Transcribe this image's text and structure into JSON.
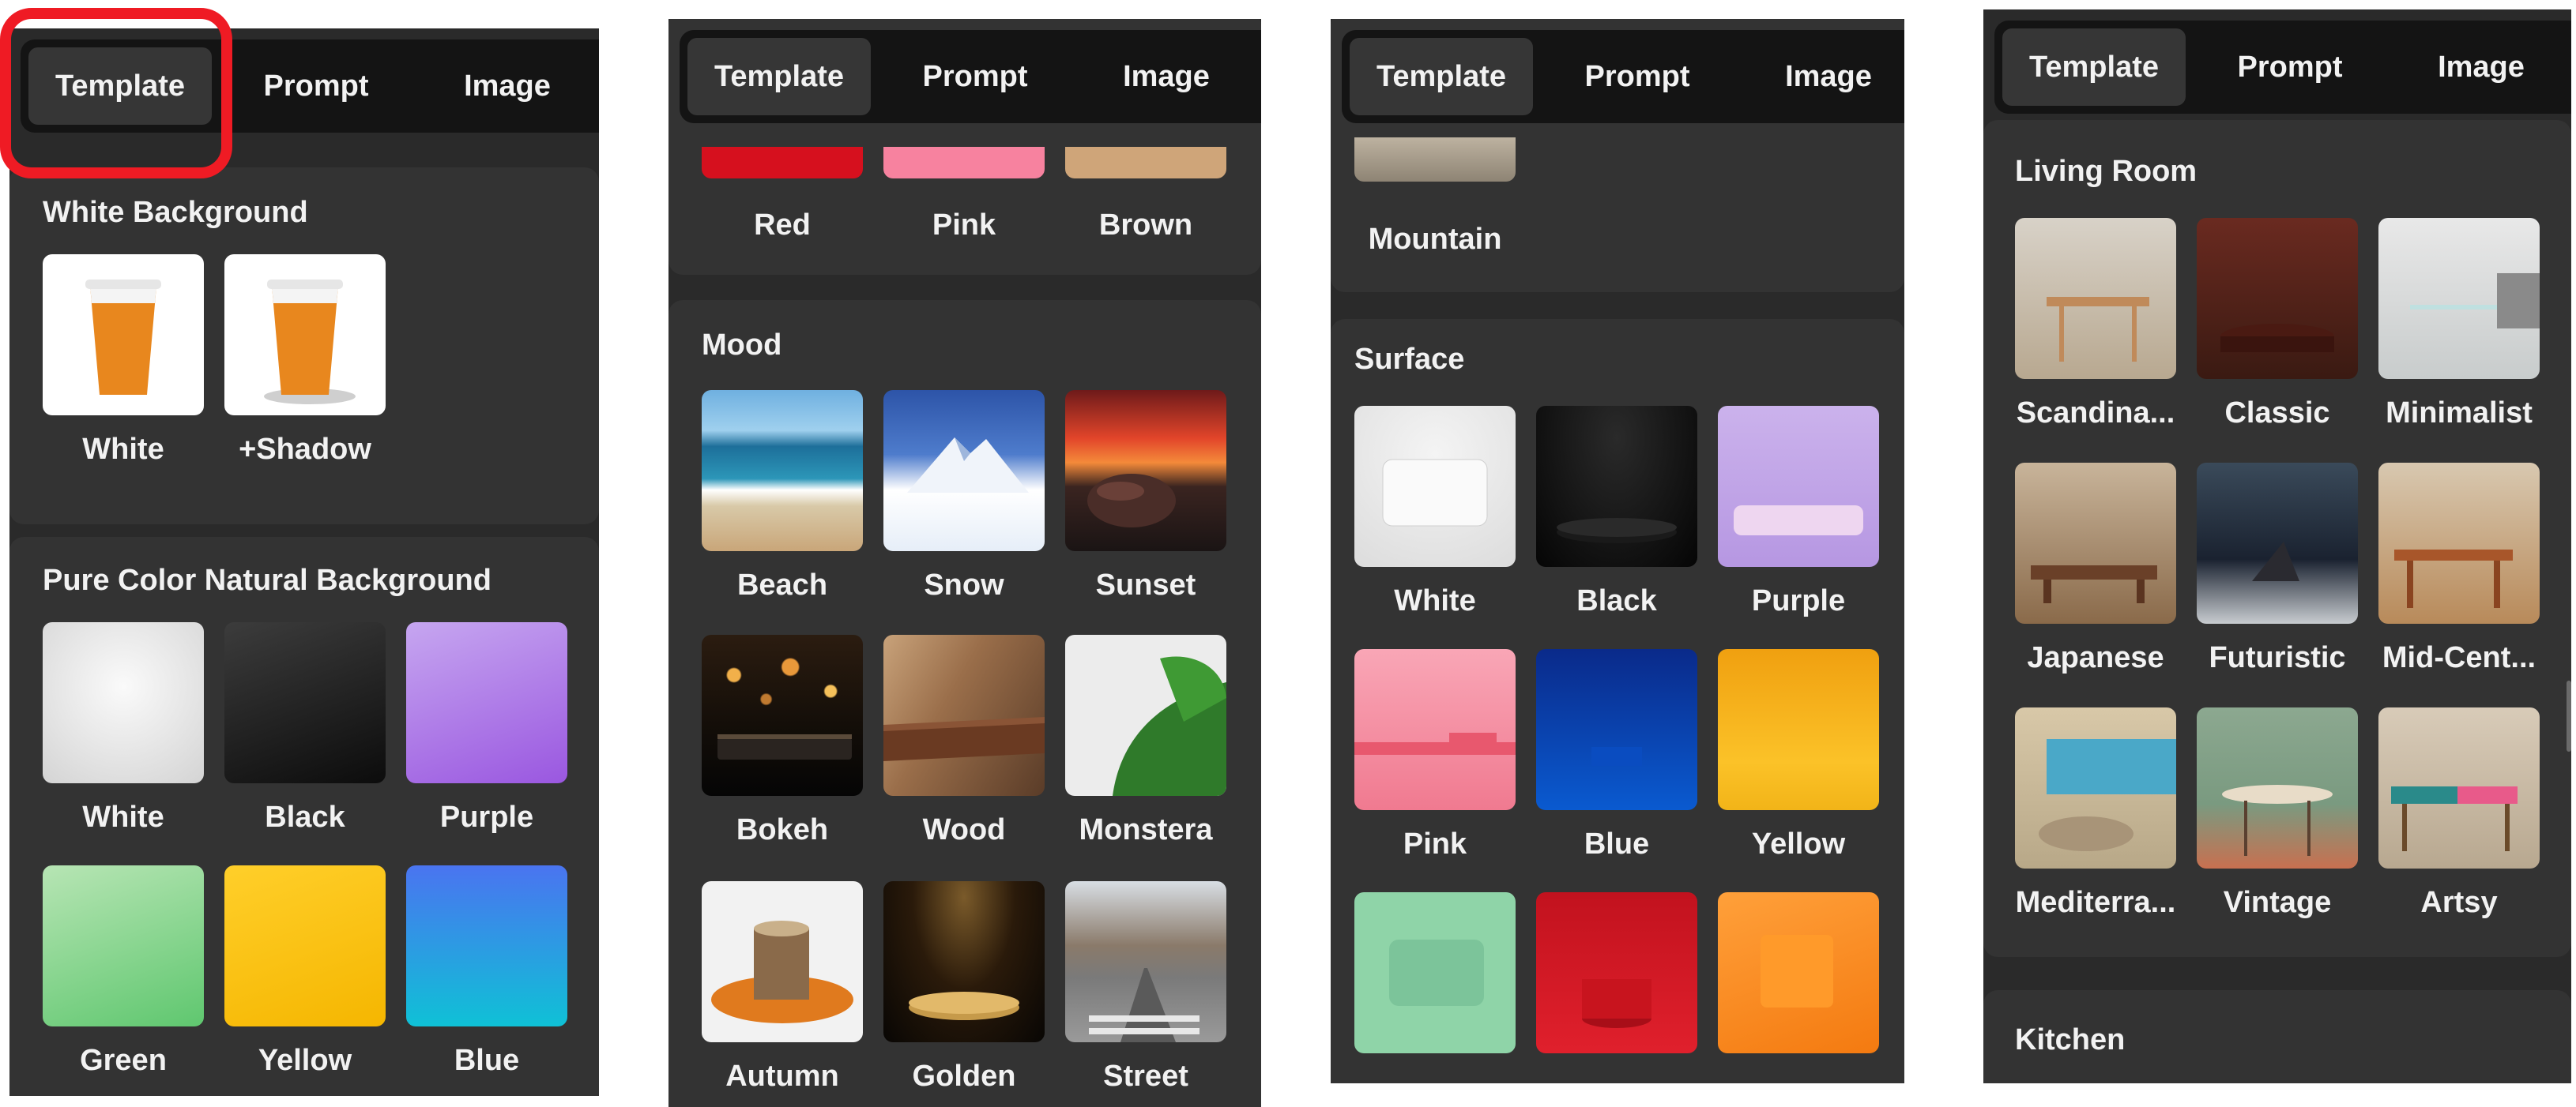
{
  "tabs": [
    "Template",
    "Prompt",
    "Image"
  ],
  "panel1": {
    "white_bg": {
      "title": "White Background",
      "items": [
        "White",
        "+Shadow"
      ]
    },
    "pure_bg": {
      "title": "Pure Color Natural Background",
      "items": [
        "White",
        "Black",
        "Purple",
        "Green",
        "Yellow",
        "Blue"
      ]
    }
  },
  "panel2": {
    "colors": {
      "items": [
        "Red",
        "Pink",
        "Brown"
      ]
    },
    "mood": {
      "title": "Mood",
      "items": [
        "Beach",
        "Snow",
        "Sunset",
        "Bokeh",
        "Wood",
        "Monstera",
        "Autumn",
        "Golden",
        "Street"
      ]
    }
  },
  "panel3": {
    "scene": {
      "items": [
        "Mountain"
      ]
    },
    "surface": {
      "title": "Surface",
      "items": [
        "White",
        "Black",
        "Purple",
        "Pink",
        "Blue",
        "Yellow"
      ]
    }
  },
  "panel4": {
    "living": {
      "title": "Living Room",
      "items": [
        "Scandina...",
        "Classic",
        "Minimalist",
        "Japanese",
        "Futuristic",
        "Mid-Cent...",
        "Mediterra...",
        "Vintage",
        "Artsy"
      ]
    },
    "kitchen": {
      "title": "Kitchen"
    }
  },
  "colors": {
    "highlight": "#ef1b24",
    "panel_bg": "#2a2a2a",
    "tab_bar": "#141414"
  }
}
